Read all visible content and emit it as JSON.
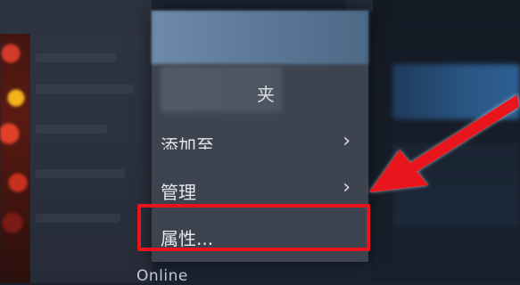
{
  "context_menu": {
    "partial_label": "夹",
    "items": [
      {
        "label": "添加至",
        "has_submenu": true
      },
      {
        "label": "管理",
        "has_submenu": true
      },
      {
        "label": "属性...",
        "has_submenu": false
      }
    ],
    "chevron_icon": "chevron-right-icon"
  },
  "status": {
    "online_label": "Online"
  },
  "annotation": {
    "highlight_color": "#e8141c",
    "arrow_color": "#e8141c"
  }
}
